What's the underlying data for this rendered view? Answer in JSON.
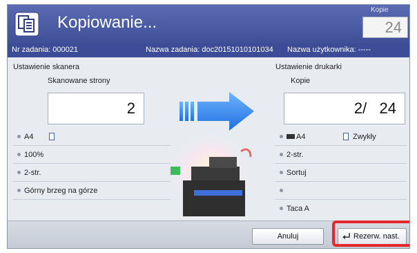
{
  "titlebar": {
    "title": "Kopiowanie...",
    "copies_label": "Kopie",
    "copies_value": "24"
  },
  "infobar": {
    "job_number": "Nr zadania: 000021",
    "job_name": "Nazwa zadania: doc20151010101034",
    "user_name": "Nazwa użytkownika: -----"
  },
  "scanner": {
    "section_title": "Ustawienie skanera",
    "pages_label": "Skanowane strony",
    "pages_value": "2",
    "rows": [
      {
        "label": "A4"
      },
      {
        "label": "100%"
      },
      {
        "label": "2-str."
      },
      {
        "label": "Górny brzeg na górze"
      }
    ]
  },
  "printer": {
    "section_title": "Ustawienie drukarki",
    "copies_label": "Kopie",
    "copies_value": "2/   24",
    "rows": [
      {
        "label": "A4",
        "extra": "Zwykły"
      },
      {
        "label": "2-str."
      },
      {
        "label": "Sortuj"
      },
      {
        "label": ""
      },
      {
        "label": "Taca A"
      }
    ]
  },
  "buttons": {
    "cancel": "Anuluj",
    "reserve_next": "Rezerw. nast."
  }
}
